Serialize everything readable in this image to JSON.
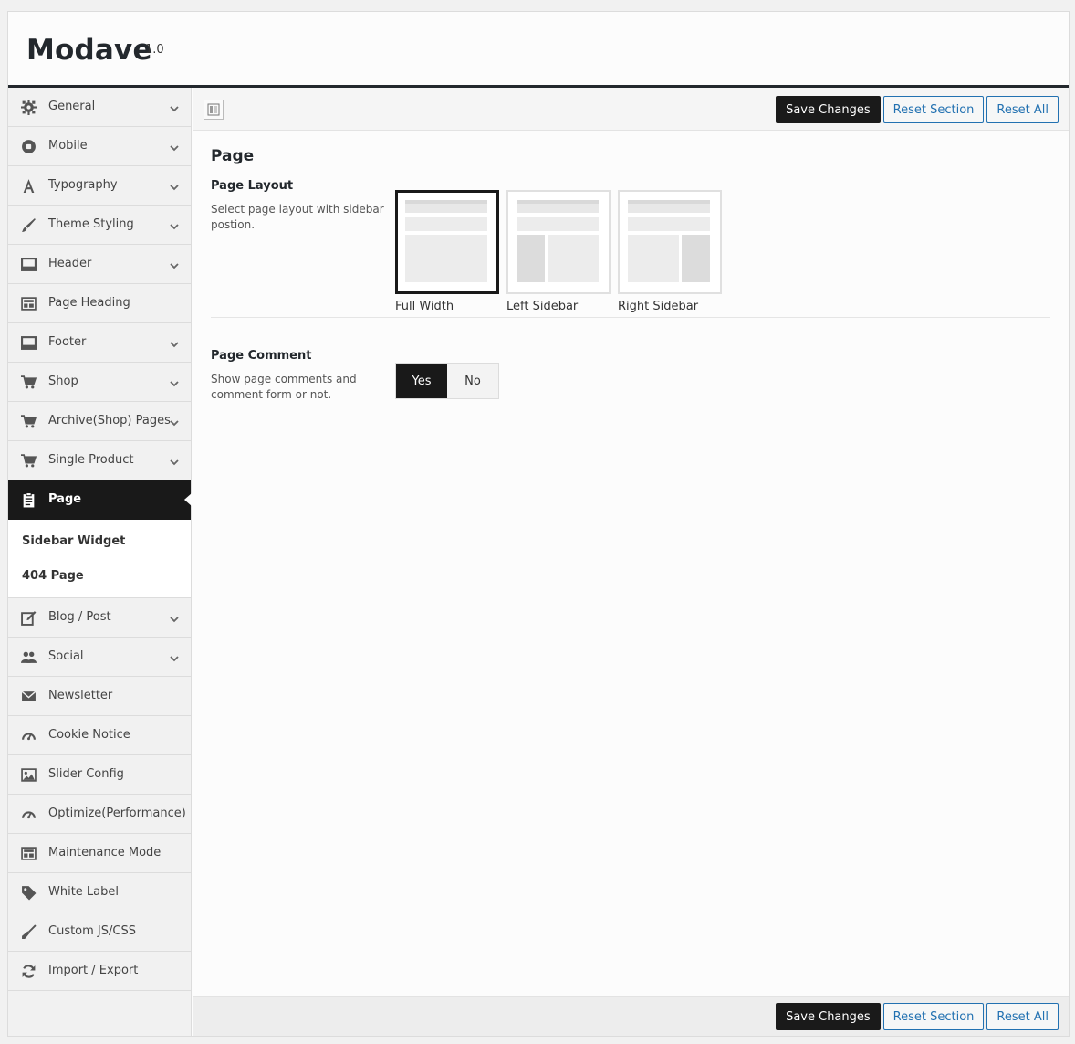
{
  "app": {
    "title": "Modave",
    "version": "1.0"
  },
  "colors": {
    "active_bg": "#191919",
    "link_blue": "#2271b1",
    "header_rule": "#23282d"
  },
  "sidebar": {
    "items": [
      {
        "label": "General",
        "icon": "gear-icon",
        "has_children": true
      },
      {
        "label": "Mobile",
        "icon": "mobile-icon",
        "has_children": true
      },
      {
        "label": "Typography",
        "icon": "font-icon",
        "has_children": true
      },
      {
        "label": "Theme Styling",
        "icon": "brush-icon",
        "has_children": true
      },
      {
        "label": "Header",
        "icon": "header-icon",
        "has_children": true
      },
      {
        "label": "Page Heading",
        "icon": "layout-icon",
        "has_children": false
      },
      {
        "label": "Footer",
        "icon": "footer-icon",
        "has_children": true
      },
      {
        "label": "Shop",
        "icon": "cart-icon",
        "has_children": true
      },
      {
        "label": "Archive(Shop) Pages",
        "icon": "cart-icon",
        "has_children": true
      },
      {
        "label": "Single Product",
        "icon": "cart-icon",
        "has_children": true
      },
      {
        "label": "Page",
        "icon": "clipboard-icon",
        "has_children": true,
        "active": true
      },
      {
        "label": "Blog / Post",
        "icon": "edit-icon",
        "has_children": true
      },
      {
        "label": "Social",
        "icon": "users-icon",
        "has_children": true
      },
      {
        "label": "Newsletter",
        "icon": "envelope-icon",
        "has_children": false
      },
      {
        "label": "Cookie Notice",
        "icon": "dashboard-icon",
        "has_children": false
      },
      {
        "label": "Slider Config",
        "icon": "image-icon",
        "has_children": false
      },
      {
        "label": "Optimize(Performance)",
        "icon": "dashboard-icon",
        "has_children": false
      },
      {
        "label": "Maintenance Mode",
        "icon": "layout-icon",
        "has_children": false
      },
      {
        "label": "White Label",
        "icon": "tag-icon",
        "has_children": false
      },
      {
        "label": "Custom JS/CSS",
        "icon": "broom-icon",
        "has_children": false
      },
      {
        "label": "Import / Export",
        "icon": "refresh-icon",
        "has_children": false
      }
    ],
    "submenu": [
      "Sidebar Widget",
      "404 Page"
    ]
  },
  "toolbar": {
    "save_label": "Save Changes",
    "reset_section_label": "Reset Section",
    "reset_all_label": "Reset All"
  },
  "main": {
    "section_title": "Page",
    "page_layout": {
      "title": "Page Layout",
      "description": "Select page layout with sidebar postion.",
      "options": [
        {
          "label": "Full Width",
          "selected": true
        },
        {
          "label": "Left Sidebar",
          "selected": false
        },
        {
          "label": "Right Sidebar",
          "selected": false
        }
      ]
    },
    "page_comment": {
      "title": "Page Comment",
      "description": "Show page comments and comment form or not.",
      "yes_label": "Yes",
      "no_label": "No",
      "value": "Yes"
    }
  }
}
